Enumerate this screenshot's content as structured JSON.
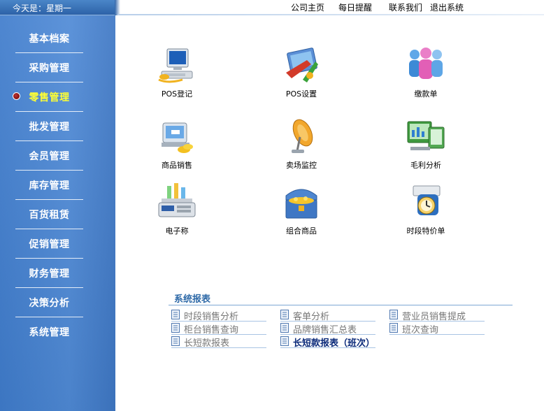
{
  "header": {
    "date_text": "今天是：星期一",
    "links": [
      "公司主页",
      "每日提醒",
      "联系我们",
      "退出系统"
    ]
  },
  "sidebar": {
    "items": [
      {
        "label": "基本档案"
      },
      {
        "label": "采购管理"
      },
      {
        "label": "零售管理",
        "active": true
      },
      {
        "label": "批发管理"
      },
      {
        "label": "会员管理"
      },
      {
        "label": "库存管理"
      },
      {
        "label": "百货租赁"
      },
      {
        "label": "促销管理"
      },
      {
        "label": "财务管理"
      },
      {
        "label": "决策分析"
      },
      {
        "label": "系统管理"
      }
    ]
  },
  "tiles": [
    {
      "label": "POS登记",
      "icon": "computer-icon"
    },
    {
      "label": "POS设置",
      "icon": "tools-icon"
    },
    {
      "label": "缴款单",
      "icon": "people-icon"
    },
    {
      "label": "商品销售",
      "icon": "sales-icon"
    },
    {
      "label": "卖场监控",
      "icon": "satellite-dish-icon"
    },
    {
      "label": "毛利分析",
      "icon": "monitors-icon"
    },
    {
      "label": "电子称",
      "icon": "scale-icon"
    },
    {
      "label": "组合商品",
      "icon": "treasure-chest-icon"
    },
    {
      "label": "时段特价单",
      "icon": "clock-icon"
    }
  ],
  "reports": {
    "title": "系统报表",
    "items": [
      {
        "label": "时段销售分析"
      },
      {
        "label": "柜台销售查询"
      },
      {
        "label": "长短款报表"
      },
      {
        "label": "客单分析"
      },
      {
        "label": "品牌销售汇总表"
      },
      {
        "label": "长短款报表（班次）",
        "bold": true
      },
      {
        "label": "营业员销售提成"
      },
      {
        "label": "班次查询"
      }
    ]
  },
  "colors": {
    "sidebar": "#4a86d2",
    "active_nav": "#ffff33",
    "report_title": "#2f6aa8"
  }
}
